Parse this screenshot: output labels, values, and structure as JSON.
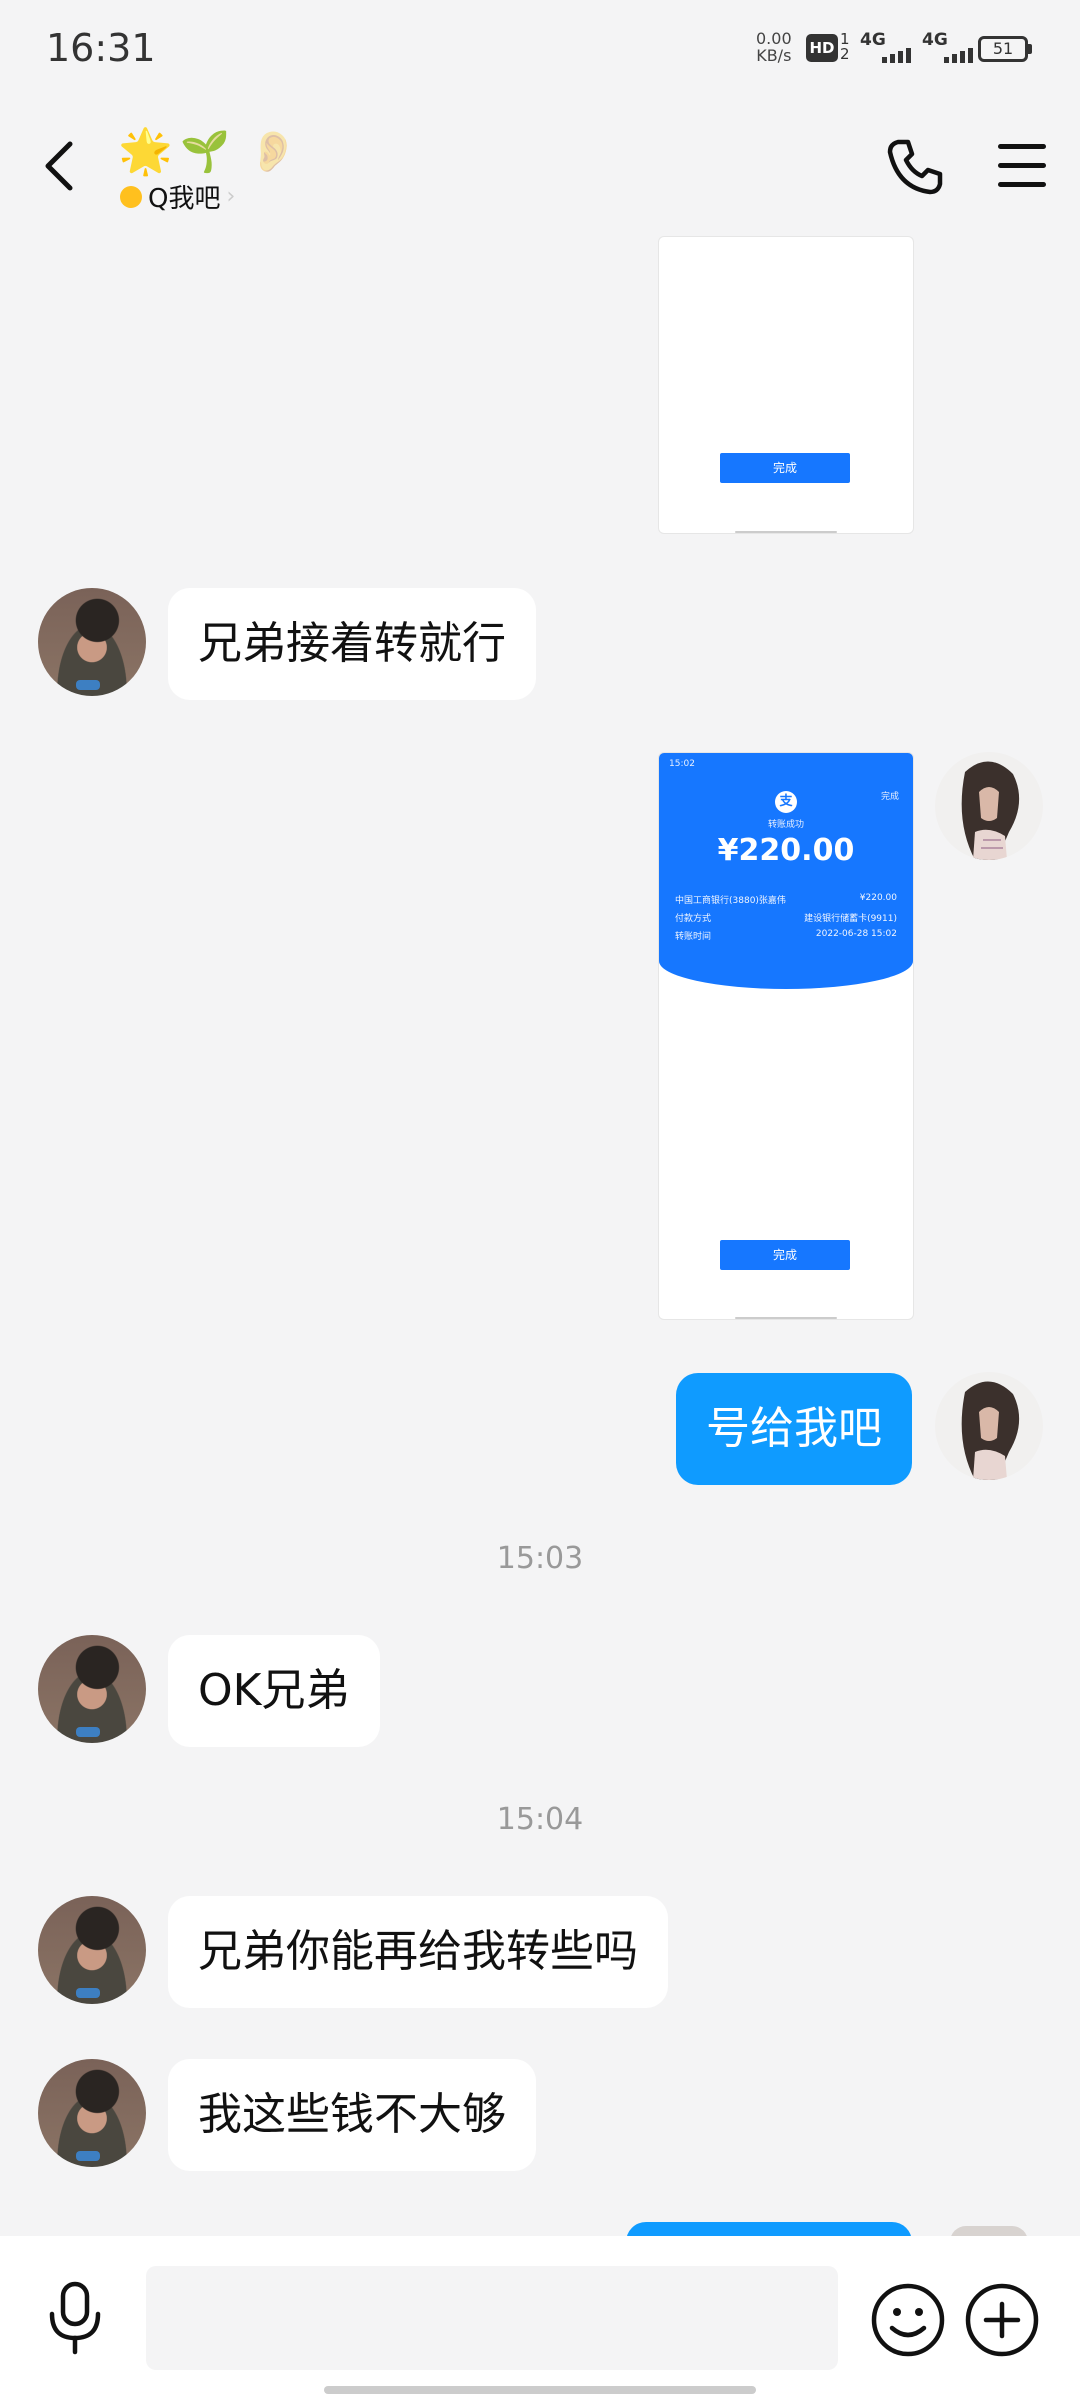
{
  "status_bar": {
    "time": "16:31",
    "speed_value": "0.00",
    "speed_unit": "KB/s",
    "hd_label": "HD",
    "hd_sub_top": "1",
    "hd_sub_bottom": "2",
    "network1": "4G",
    "network2": "4G",
    "battery": "51"
  },
  "header": {
    "title_emojis": [
      "🌟",
      "🌱",
      "👂"
    ],
    "subtitle": "Q我吧",
    "back_icon": "back-arrow-icon",
    "call_icon": "phone-icon",
    "menu_icon": "menu-icon"
  },
  "messages": {
    "m1": "兄弟接着转就行",
    "m2": "号给我吧",
    "m3": "OK兄弟",
    "m4": "兄弟你能再给我转些吗",
    "m5": "我这些钱不大够"
  },
  "timestamps": {
    "t1": "15:03",
    "t2": "15:04"
  },
  "screenshot_top": {
    "button": "完成"
  },
  "screenshot_payment": {
    "time": "15:02",
    "status": "转账成功",
    "done": "完成",
    "amount": "¥220.00",
    "row1_label": "中国工商银行(3880)张嘉伟",
    "row1_value": "¥220.00",
    "row2_label": "付款方式",
    "row2_value": "建设银行储蓄卡(9911)",
    "row3_label": "转账时间",
    "row3_value": "2022-06-28 15:02",
    "button": "完成"
  },
  "input": {
    "placeholder": ""
  },
  "colors": {
    "bubble_blue": "#0f9bff",
    "accent_blue": "#1677ff",
    "background": "#f4f4f5"
  }
}
